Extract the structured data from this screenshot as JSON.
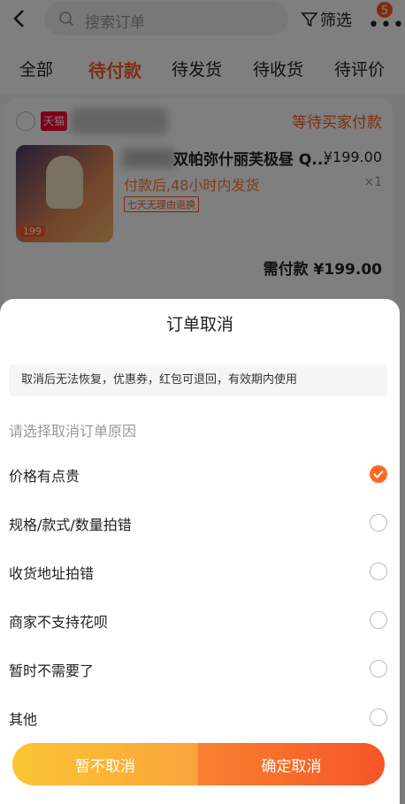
{
  "header": {
    "search_placeholder": "搜索订单",
    "filter_label": "筛选",
    "more_dots": "•••",
    "notification_count": "5"
  },
  "tabs": [
    {
      "label": "全部",
      "active": false
    },
    {
      "label": "待付款",
      "active": true
    },
    {
      "label": "待发货",
      "active": false
    },
    {
      "label": "待收货",
      "active": false
    },
    {
      "label": "待评价",
      "active": false
    }
  ],
  "order": {
    "store_badge": "天猫",
    "status": "等待买家付款",
    "title": "双帕弥什丽芙极昼 Q...",
    "price": "¥199.00",
    "shipping": "付款后,48小时内发货",
    "quantity": "×1",
    "return_tag": "七天无理由退换",
    "thumb_price": "199",
    "total_label": "需付款 ¥199.00"
  },
  "sheet": {
    "title": "订单取消",
    "notice": "取消后无法恢复，优惠券，红包可退回，有效期内使用",
    "prompt": "请选择取消订单原因",
    "reasons": [
      {
        "label": "价格有点贵",
        "checked": true
      },
      {
        "label": "规格/款式/数量拍错",
        "checked": false
      },
      {
        "label": "收货地址拍错",
        "checked": false
      },
      {
        "label": "商家不支持花呗",
        "checked": false
      },
      {
        "label": "暂时不需要了",
        "checked": false
      },
      {
        "label": "其他",
        "checked": false
      }
    ],
    "cancel_label": "暂不取消",
    "confirm_label": "确定取消"
  },
  "colors": {
    "accent": "#ff5a20",
    "cancel_gradient_start": "#fbc534",
    "confirm_gradient_end": "#f65527"
  }
}
